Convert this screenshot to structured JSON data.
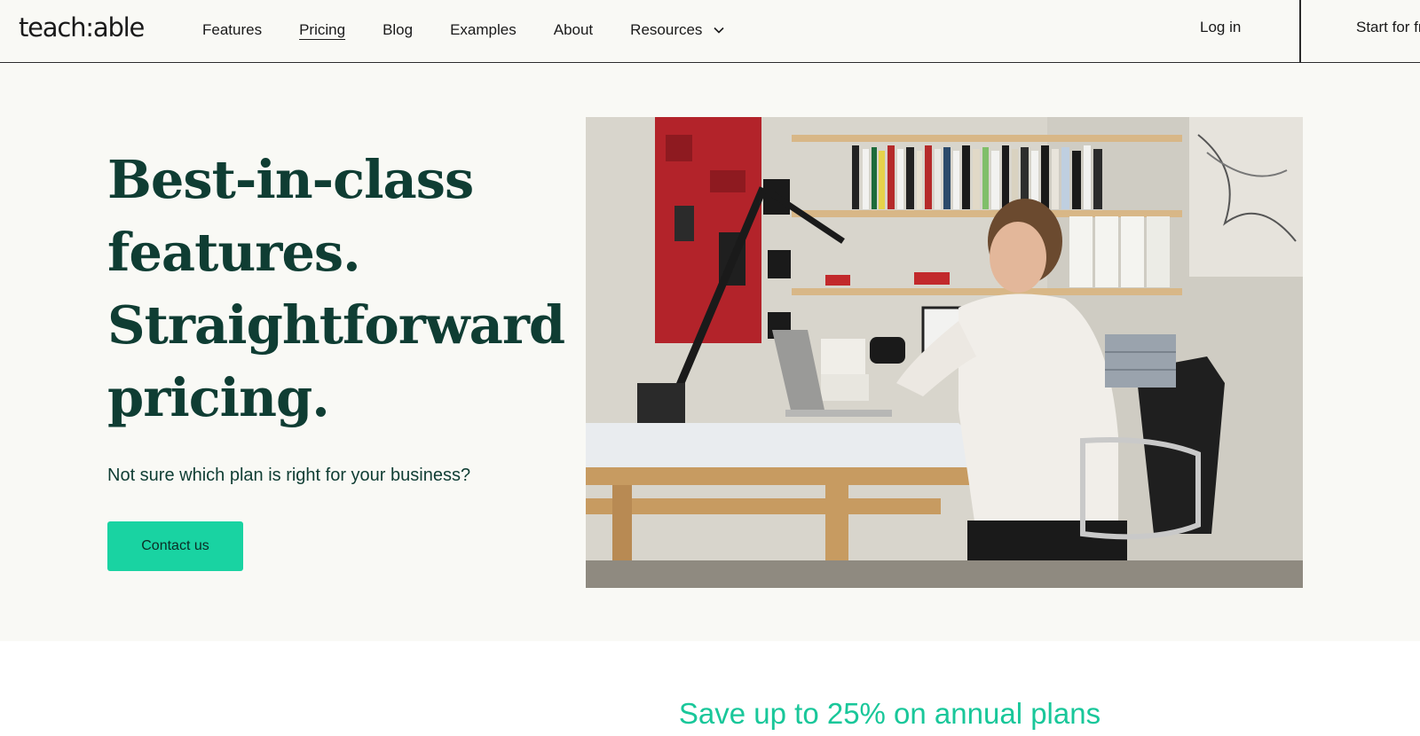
{
  "nav": {
    "logo": "teach:able",
    "links": [
      {
        "label": "Features"
      },
      {
        "label": "Pricing",
        "active": true
      },
      {
        "label": "Blog"
      },
      {
        "label": "Examples"
      },
      {
        "label": "About"
      },
      {
        "label": "Resources",
        "has_dropdown": true
      }
    ],
    "login_label": "Log in",
    "start_label": "Start for free"
  },
  "hero": {
    "headline_lines": [
      "Best-in-class",
      "features.",
      "Straightforward",
      "pricing."
    ],
    "subtext": "Not sure which plan is right for your business?",
    "cta_label": "Contact us"
  },
  "promo": {
    "text": "Save up to 25% on annual plans"
  },
  "colors": {
    "accent": "#19d3a2",
    "headline": "#0f3d33",
    "background": "#f9f9f5",
    "promo_text": "#19c79a"
  }
}
